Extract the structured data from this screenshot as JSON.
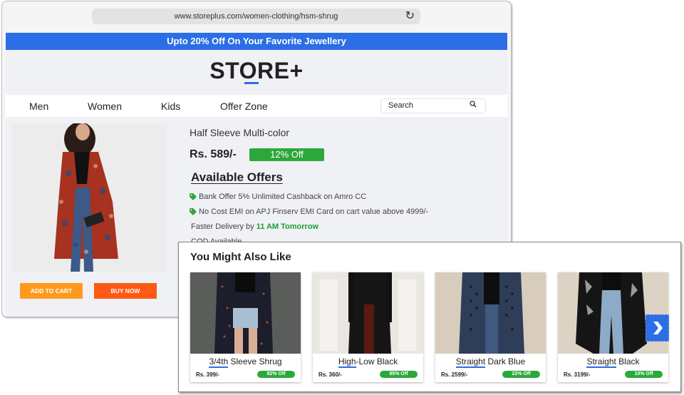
{
  "browser": {
    "url": "www.storeplus.com/women-clothing/hsm-shrug",
    "reload_icon": "reload-icon"
  },
  "promo": {
    "text": "Upto 20% Off On Your Favorite Jewellery"
  },
  "logo": {
    "text": "STORE+"
  },
  "nav": {
    "items": [
      "Men",
      "Women",
      "Kids",
      "Offer Zone"
    ],
    "search_placeholder": "Search",
    "search_icon": "search-icon"
  },
  "product": {
    "title": "Half Sleeve Multi-color",
    "price": "Rs. 589/-",
    "discount": "12% Off",
    "offers_heading": "Available Offers",
    "offers": [
      "Bank Offer 5% Unlimited Cashback on Amro CC",
      "No Cost EMI on APJ Finserv EMI Card on cart value above 4999/-"
    ],
    "delivery_prefix": "Faster Delivery by ",
    "delivery_time": "11 AM Tomorrow",
    "cod": "COD Available",
    "add_to_cart": "ADD TO CART",
    "buy_now": "BUY NOW"
  },
  "recommendations": {
    "title": "You Might Also Like",
    "items": [
      {
        "name_underlined": "3/4th",
        "name_rest": " Sleeve Shrug",
        "price": "Rs. 399/-",
        "discount": "82% Off"
      },
      {
        "name_underlined": "High",
        "name_rest": "-Low Black",
        "price": "Rs. 360/-",
        "discount": "85% Off"
      },
      {
        "name_underlined": "Straight",
        "name_rest": " Dark Blue",
        "price": "Rs. 2599/-",
        "discount": "22% Off"
      },
      {
        "name_underlined": "Straight",
        "name_rest": " Black",
        "price": "Rs. 3199/-",
        "discount": "10% Off"
      }
    ],
    "next_icon": "chevron-right-icon"
  },
  "colors": {
    "accent_blue": "#2b6ee6",
    "badge_green": "#2ca83b",
    "add_to_cart_orange": "#ff9a1f",
    "buy_now_orange": "#ff5a14"
  }
}
